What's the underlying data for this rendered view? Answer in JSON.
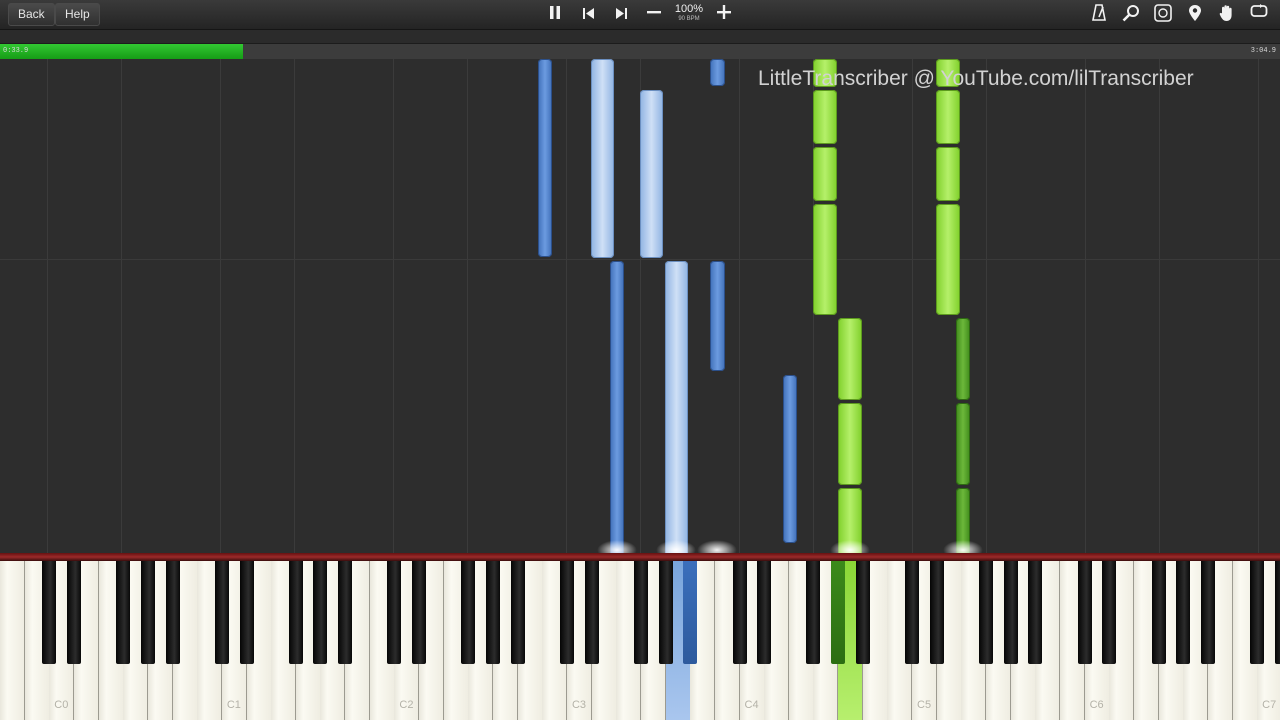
{
  "toolbar": {
    "back_label": "Back",
    "help_label": "Help",
    "speed_percent": "100%",
    "tempo": "90 BPM",
    "icons": [
      "pause-icon",
      "skip-back-icon",
      "skip-forward-icon",
      "minus-icon",
      "plus-icon",
      "metronome-icon",
      "zoom-icon",
      "key-signature-icon",
      "marker-icon",
      "hand-icon",
      "loop-icon"
    ]
  },
  "progress": {
    "elapsed": "0:33.9",
    "total": "3:04.9",
    "fraction": 0.19
  },
  "watermark": "LittleTranscriber @ YouTube.com/lilTranscriber",
  "keyboard": {
    "octave_labels": [
      "C0",
      "C1",
      "C2",
      "C3",
      "C4",
      "C5",
      "C6",
      "C7"
    ]
  },
  "colors": {
    "left_hand": "#5b8bd6",
    "right_hand": "#9fe04a",
    "progress": "#22b022"
  }
}
